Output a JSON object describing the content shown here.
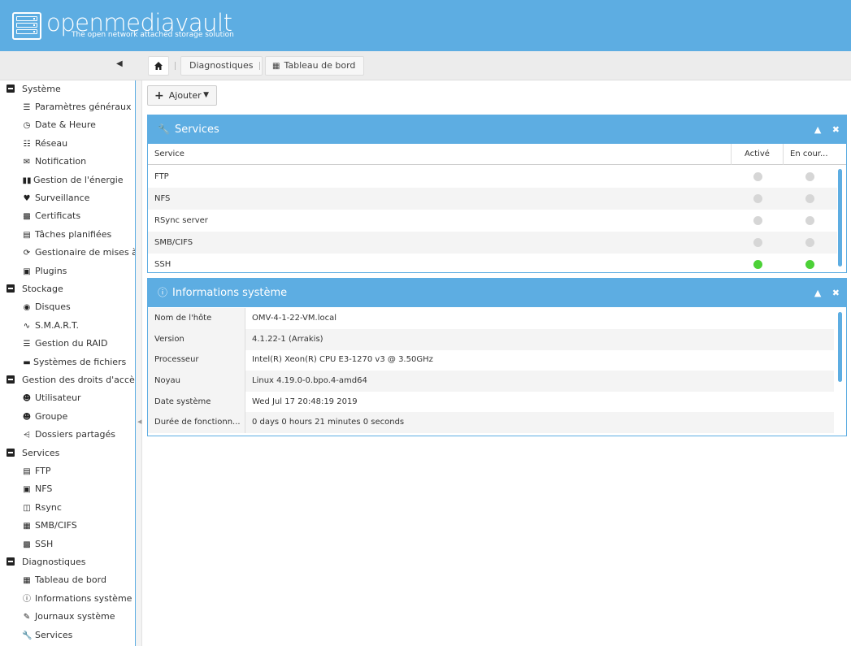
{
  "header": {
    "brand": "openmediavault",
    "tagline": "The open network attached storage solution"
  },
  "breadcrumb": {
    "home_icon": "home-icon",
    "items": [
      "Diagnostiques",
      "Tableau de bord"
    ]
  },
  "sidebar": {
    "groups": [
      {
        "label": "Système",
        "items": [
          {
            "icon": "sliders-icon",
            "label": "Paramètres généraux"
          },
          {
            "icon": "clock-icon",
            "label": "Date & Heure"
          },
          {
            "icon": "network-icon",
            "label": "Réseau"
          },
          {
            "icon": "envelope-icon",
            "label": "Notification"
          },
          {
            "icon": "battery-icon",
            "label": "Gestion de l'énergie"
          },
          {
            "icon": "heartbeat-icon",
            "label": "Surveillance"
          },
          {
            "icon": "certificate-icon",
            "label": "Certificats"
          },
          {
            "icon": "calendar-clock-icon",
            "label": "Tâches planifiées"
          },
          {
            "icon": "refresh-icon",
            "label": "Gestionaire de mises à jour"
          },
          {
            "icon": "puzzle-icon",
            "label": "Plugins"
          }
        ]
      },
      {
        "label": "Stockage",
        "items": [
          {
            "icon": "disk-icon",
            "label": "Disques"
          },
          {
            "icon": "pulse-icon",
            "label": "S.M.A.R.T."
          },
          {
            "icon": "database-icon",
            "label": "Gestion du RAID"
          },
          {
            "icon": "folder-icon",
            "label": "Systèmes de fichiers"
          }
        ]
      },
      {
        "label": "Gestion des droits d'accès",
        "items": [
          {
            "icon": "user-icon",
            "label": "Utilisateur"
          },
          {
            "icon": "users-icon",
            "label": "Groupe"
          },
          {
            "icon": "share-icon",
            "label": "Dossiers partagés"
          }
        ]
      },
      {
        "label": "Services",
        "items": [
          {
            "icon": "server-icon",
            "label": "FTP"
          },
          {
            "icon": "desktop-icon",
            "label": "NFS"
          },
          {
            "icon": "sync-icon",
            "label": "Rsync"
          },
          {
            "icon": "windows-icon",
            "label": "SMB/CIFS"
          },
          {
            "icon": "terminal-icon",
            "label": "SSH"
          }
        ]
      },
      {
        "label": "Diagnostiques",
        "items": [
          {
            "icon": "dashboard-icon",
            "label": "Tableau de bord"
          },
          {
            "icon": "info-icon",
            "label": "Informations système"
          },
          {
            "icon": "edit-icon",
            "label": "Journaux système"
          },
          {
            "icon": "wrench-icon",
            "label": "Services"
          }
        ]
      }
    ]
  },
  "toolbar": {
    "add_label": "Ajouter"
  },
  "services_panel": {
    "title": "Services",
    "columns": [
      "Service",
      "Activé",
      "En cour..."
    ],
    "rows": [
      {
        "name": "FTP",
        "enabled": false,
        "running": false
      },
      {
        "name": "NFS",
        "enabled": false,
        "running": false
      },
      {
        "name": "RSync server",
        "enabled": false,
        "running": false
      },
      {
        "name": "SMB/CIFS",
        "enabled": false,
        "running": false
      },
      {
        "name": "SSH",
        "enabled": true,
        "running": true
      }
    ]
  },
  "sysinfo_panel": {
    "title": "Informations système",
    "rows": [
      {
        "key": "Nom de l'hôte",
        "value": "OMV-4-1-22-VM.local"
      },
      {
        "key": "Version",
        "value": "4.1.22-1 (Arrakis)"
      },
      {
        "key": "Processeur",
        "value": "Intel(R) Xeon(R) CPU E3-1270 v3 @ 3.50GHz"
      },
      {
        "key": "Noyau",
        "value": "Linux 4.19.0-0.bpo.4-amd64"
      },
      {
        "key": "Date système",
        "value": "Wed Jul 17 20:48:19 2019"
      },
      {
        "key": "Durée de fonctionn...",
        "value": "0 days 0 hours 21 minutes 0 seconds"
      }
    ]
  },
  "colors": {
    "accent": "#5dade2",
    "status_on": "#4cd137",
    "status_off": "#d6d6d6"
  }
}
